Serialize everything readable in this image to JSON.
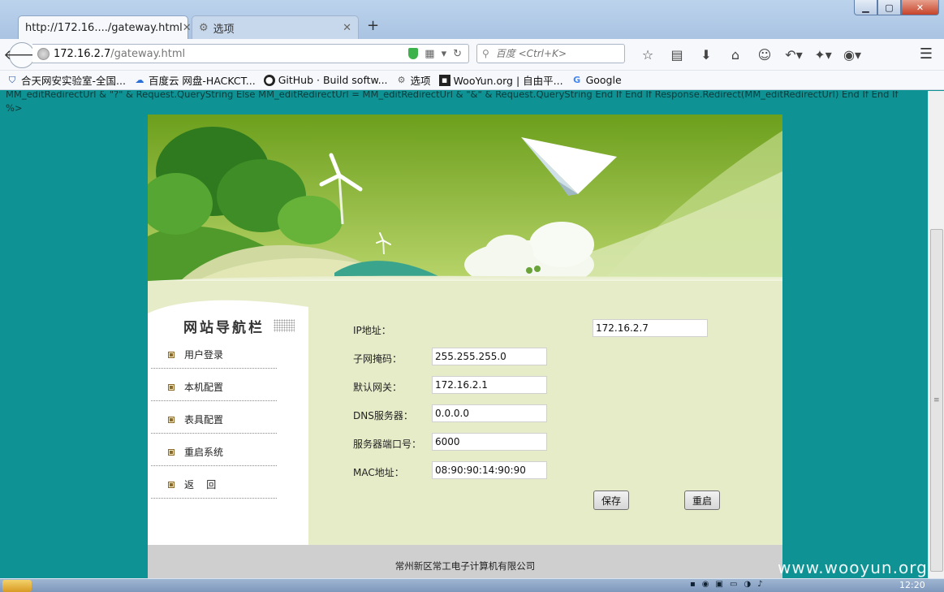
{
  "browser": {
    "tabs": [
      {
        "label": "http://172.16..../gateway.html",
        "active": true
      },
      {
        "label": "选项",
        "active": false
      }
    ],
    "new_tab": "+",
    "url_host": "172.16.2.7",
    "url_path": "/gateway.html",
    "search_placeholder": "百度 <Ctrl+K>",
    "bookmarks": [
      {
        "label": "合天网安实验室-全国..."
      },
      {
        "label": "百度云 网盘-HACKCT..."
      },
      {
        "label": "GitHub · Build softw..."
      },
      {
        "label": "选项"
      },
      {
        "label": "WooYun.org | 自由平..."
      },
      {
        "label": "Google"
      }
    ]
  },
  "page": {
    "asp_code": "MM_editRedirectUrl & \"?\" & Request.QueryString Else MM_editRedirectUrl = MM_editRedirectUrl & \"&\" & Request.QueryString End If End If Response.Redirect(MM_editRedirectUrl) End If End If %>",
    "nav_title": "网站导航栏",
    "nav_items": [
      {
        "label": "用户登录"
      },
      {
        "label": "本机配置"
      },
      {
        "label": "表具配置"
      },
      {
        "label": "重启系统"
      },
      {
        "label": "返    回"
      }
    ],
    "form": {
      "fields": [
        {
          "label": "IP地址：",
          "value": "172.16.2.7"
        },
        {
          "label": "子网掩码：",
          "value": "255.255.255.0"
        },
        {
          "label": "默认网关：",
          "value": "172.16.2.1"
        },
        {
          "label": "DNS服务器：",
          "value": "0.0.0.0"
        },
        {
          "label": "服务器端口号：",
          "value": "6000"
        },
        {
          "label": "MAC地址：",
          "value": "08:90:90:14:90:90"
        }
      ],
      "save_label": "保存",
      "restart_label": "重启"
    },
    "footer": "常州新区常工电子计算机有限公司"
  },
  "watermark": "www.wooyun.org",
  "taskbar": {
    "clock": "12:20"
  }
}
